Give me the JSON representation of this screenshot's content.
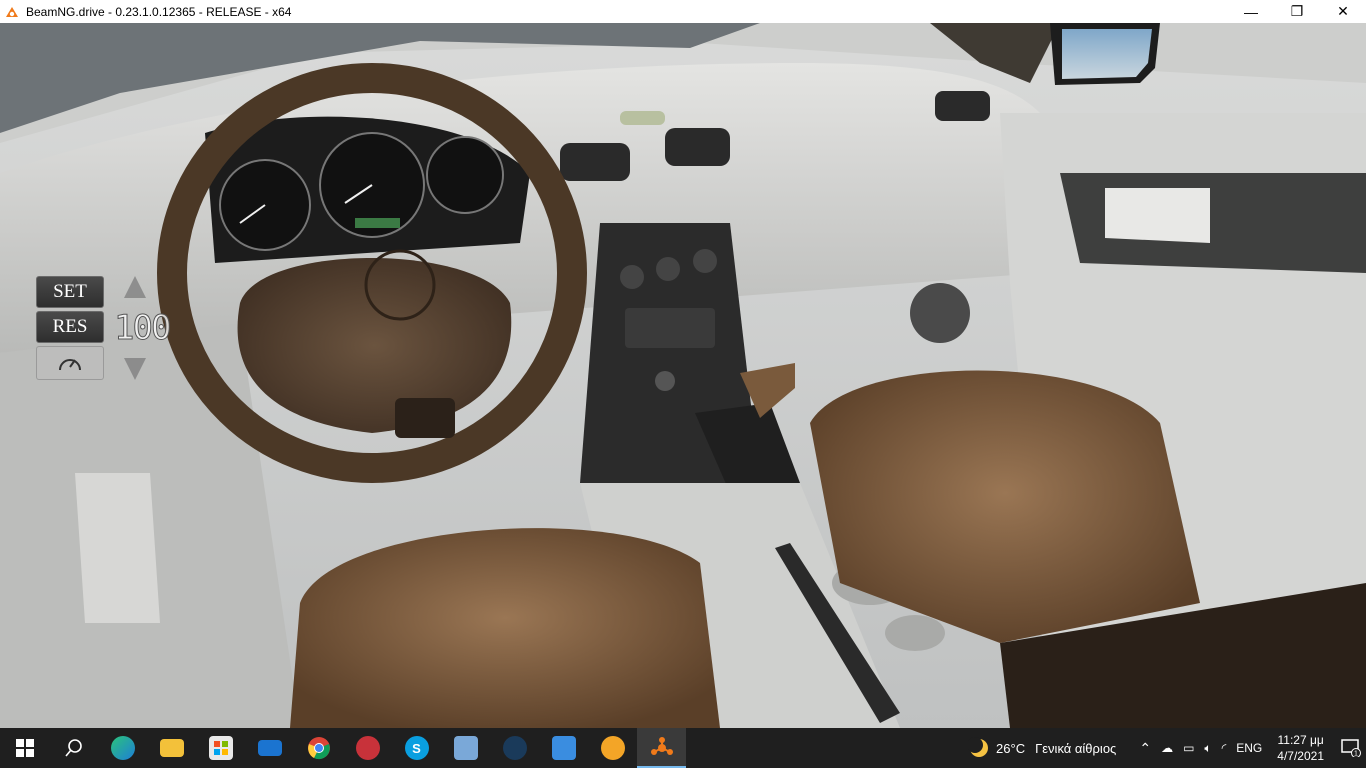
{
  "window": {
    "title": "BeamNG.drive - 0.23.1.0.12365 - RELEASE - x64",
    "icon": "beamng-logo-icon",
    "controls": {
      "minimize": "—",
      "maximize": "❐",
      "close": "✕"
    }
  },
  "hud": {
    "cruise_control": {
      "set_label": "SET",
      "res_label": "RES",
      "speed": "100",
      "icons": [
        "speedometer-icon",
        "arrow-up-icon",
        "arrow-down-icon"
      ]
    }
  },
  "taskbar": {
    "apps": [
      {
        "name": "start",
        "icon": "windows-start-icon"
      },
      {
        "name": "search",
        "icon": "search-icon"
      },
      {
        "name": "edge",
        "icon": "edge-icon"
      },
      {
        "name": "file-explorer",
        "icon": "folder-icon"
      },
      {
        "name": "store",
        "icon": "store-icon"
      },
      {
        "name": "mail",
        "icon": "mail-icon"
      },
      {
        "name": "chrome",
        "icon": "chrome-icon"
      },
      {
        "name": "app-red",
        "icon": "red-app-icon"
      },
      {
        "name": "skype",
        "icon": "skype-icon"
      },
      {
        "name": "photos",
        "icon": "photos-icon"
      },
      {
        "name": "steam",
        "icon": "steam-icon"
      },
      {
        "name": "app-blue",
        "icon": "blue-app-icon"
      },
      {
        "name": "brave",
        "icon": "brave-icon"
      },
      {
        "name": "beamng",
        "icon": "beamng-icon",
        "active": true
      }
    ],
    "tray": {
      "weather_temp": "26°C",
      "weather_desc": "Γενικά αίθριος",
      "language": "ENG",
      "time": "11:27 μμ",
      "date": "4/7/2021",
      "notification_count": "1"
    }
  }
}
